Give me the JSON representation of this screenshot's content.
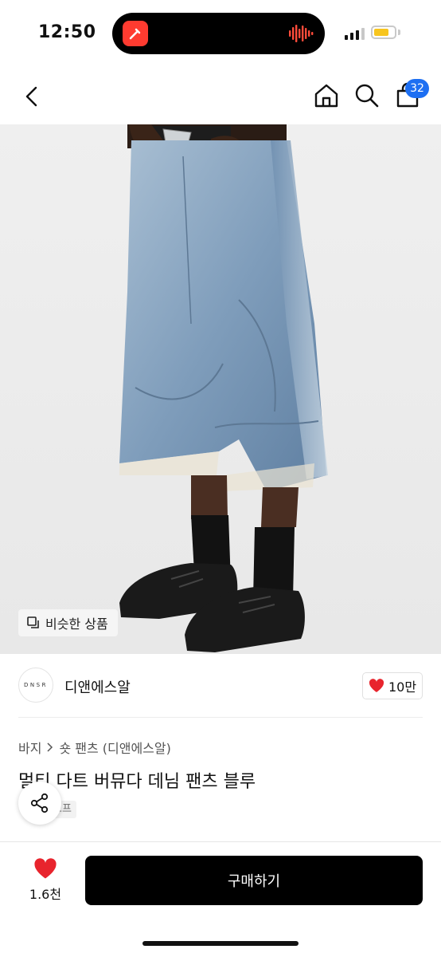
{
  "status_bar": {
    "time": "12:50",
    "signal_icon": "signal-icon",
    "battery_icon": "battery-icon",
    "battery_color": "#f7c51e"
  },
  "nav": {
    "back_icon": "chevron-left-icon",
    "home_icon": "home-icon",
    "search_icon": "search-icon",
    "bag_icon": "shopping-bag-icon",
    "cart_badge": "32",
    "badge_color": "#1d6ff2"
  },
  "photo": {
    "similar_label": "비슷한 상품",
    "similar_icon": "copy-icon"
  },
  "brand": {
    "logo_text": "DNSR",
    "name": "디앤에스알",
    "like_count": "10만",
    "heart_color": "#e8242d"
  },
  "breadcrumb": {
    "category": "바지",
    "subcategory": "숏 팬츠 (디앤에스알)"
  },
  "product": {
    "title": "멀티 다트 버뮤다 데님 팬츠 블루",
    "tag": "오프"
  },
  "bottom_bar": {
    "wish_count": "1.6천",
    "buy_label": "구매하기"
  }
}
